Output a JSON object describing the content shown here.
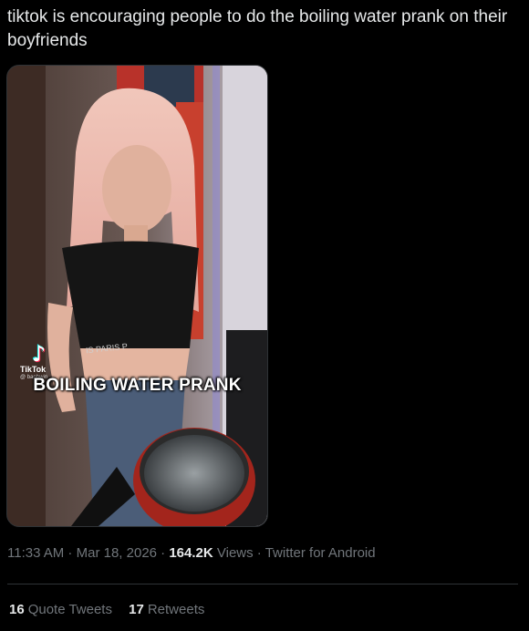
{
  "tweet": {
    "text": "tiktok is encouraging people to do the boiling water prank on their boyfriends"
  },
  "video": {
    "caption": "BOILING WATER PRANK",
    "watermark_app": "TikTok",
    "watermark_handle": "@ baohwin",
    "shirt_text": "IS   PARIS   P"
  },
  "meta": {
    "time": "11:33 AM",
    "sep1": " · ",
    "date": "Mar 18, 2026",
    "sep2": " · ",
    "views_count": "164.2K",
    "views_label": " Views",
    "sep3": " · ",
    "source": "Twitter for Android"
  },
  "stats": {
    "quote_count": "16",
    "quote_label": "Quote Tweets",
    "retweet_count": "17",
    "retweet_label": "Retweets"
  },
  "colors": {
    "background": "#000000",
    "text": "#e7e9ea",
    "muted": "#71767b",
    "divider": "#2f3336"
  }
}
